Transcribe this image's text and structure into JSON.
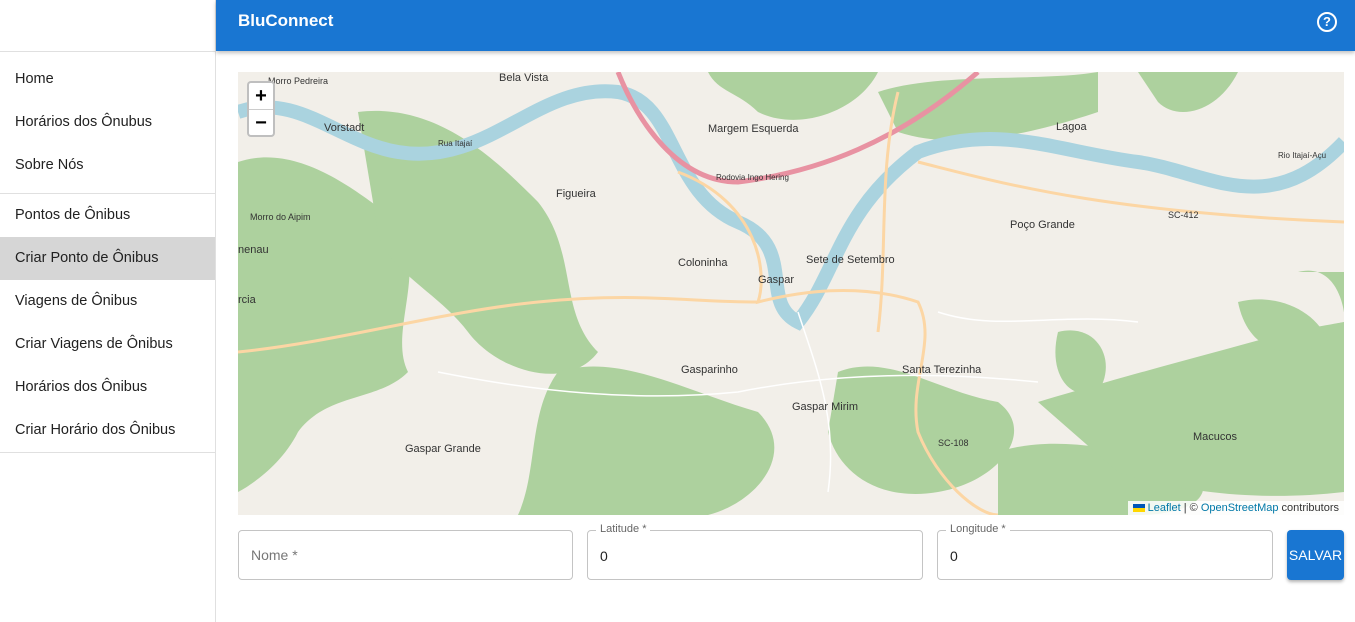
{
  "app": {
    "title": "BluConnect"
  },
  "sidebar": {
    "groups": [
      [
        "Home",
        "Horários dos Ônubus",
        "Sobre Nós"
      ],
      [
        "Pontos de Ônibus",
        "Criar Ponto de Ônibus",
        "Viagens de Ônibus",
        "Criar Viagens de Ônibus",
        "Horários dos Ônibus",
        "Criar Horário dos Ônibus"
      ]
    ],
    "active": "Criar Ponto de Ônibus"
  },
  "map": {
    "zoom_in": "+",
    "zoom_out": "−",
    "places": [
      "Bela Vista",
      "Vorstadt",
      "Margem Esquerda",
      "Lagoa",
      "Figueira",
      "Poço Grande",
      "Coloninha",
      "Gaspar",
      "Sete de Setembro",
      "Gasparinho",
      "Santa Terezinha",
      "Gaspar Mirim",
      "Gaspar Grande",
      "Macucos",
      "SC-412",
      "SC-108",
      "Rodovia Ingo Hering",
      "Rio Itajaí-Açu",
      "Rua Itajaí",
      "Morro Pedreira",
      "Morro do Aipim",
      "nenau",
      "rcia"
    ],
    "attribution": {
      "leaflet": "Leaflet",
      "sep": " | © ",
      "osm": "OpenStreetMap",
      "suffix": " contributors"
    }
  },
  "form": {
    "nome": {
      "placeholder": "Nome *"
    },
    "latitude": {
      "label": "Latitude *",
      "value": "0"
    },
    "longitude": {
      "label": "Longitude *",
      "value": "0"
    },
    "save_label": "SALVAR"
  }
}
